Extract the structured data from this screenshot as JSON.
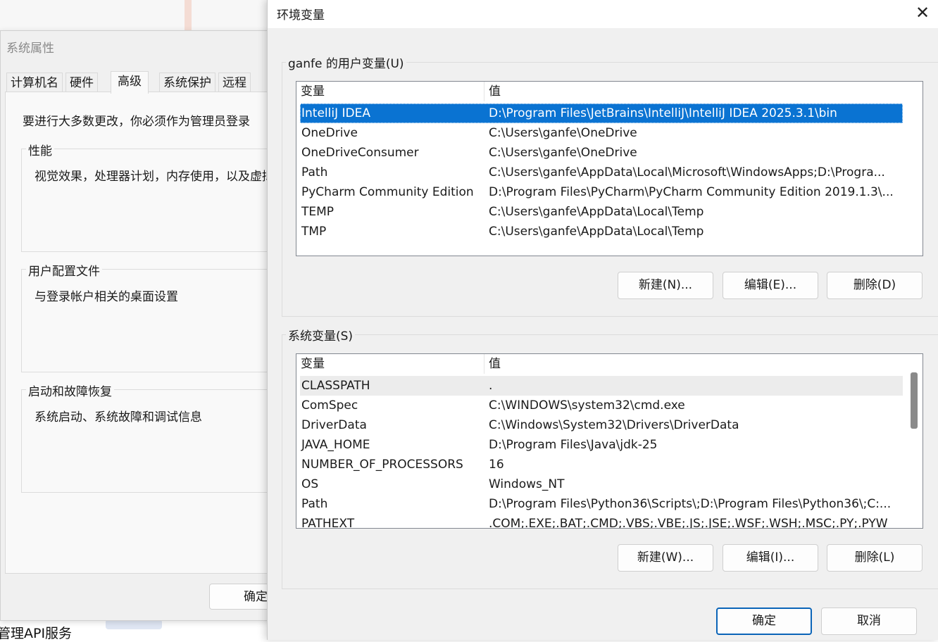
{
  "background": {
    "bottom_text": "管理API服务"
  },
  "system_properties": {
    "title": "系统属性",
    "tabs": [
      {
        "label": "计算机名"
      },
      {
        "label": "硬件"
      },
      {
        "label": "高级",
        "active": true
      },
      {
        "label": "系统保护"
      },
      {
        "label": "远程"
      }
    ],
    "admin_note": "要进行大多数更改，你必须作为管理员登录",
    "groups": [
      {
        "title": "性能",
        "desc": "视觉效果，处理器计划，内存使用，以及虚拟内存"
      },
      {
        "title": "用户配置文件",
        "desc": "与登录帐户相关的桌面设置"
      },
      {
        "title": "启动和故障恢复",
        "desc": "系统启动、系统故障和调试信息"
      }
    ],
    "ok_label": "确定"
  },
  "env_dialog": {
    "title": "环境变量",
    "close_glyph": "✕",
    "user_section": {
      "title": "ganfe 的用户变量(U)",
      "col_var": "变量",
      "col_val": "值",
      "rows": [
        {
          "var": "IntelliJ IDEA",
          "val": "D:\\Program Files\\JetBrains\\IntelliJ\\IntelliJ IDEA 2025.3.1\\bin",
          "selected": true
        },
        {
          "var": "OneDrive",
          "val": "C:\\Users\\ganfe\\OneDrive"
        },
        {
          "var": "OneDriveConsumer",
          "val": "C:\\Users\\ganfe\\OneDrive"
        },
        {
          "var": "Path",
          "val": "C:\\Users\\ganfe\\AppData\\Local\\Microsoft\\WindowsApps;D:\\Progra..."
        },
        {
          "var": "PyCharm Community Edition",
          "val": "D:\\Program Files\\PyCharm\\PyCharm Community Edition 2019.1.3\\..."
        },
        {
          "var": "TEMP",
          "val": "C:\\Users\\ganfe\\AppData\\Local\\Temp"
        },
        {
          "var": "TMP",
          "val": "C:\\Users\\ganfe\\AppData\\Local\\Temp"
        }
      ],
      "new_label": "新建(N)...",
      "edit_label": "编辑(E)...",
      "delete_label": "删除(D)"
    },
    "system_section": {
      "title": "系统变量(S)",
      "col_var": "变量",
      "col_val": "值",
      "rows": [
        {
          "var": "CLASSPATH",
          "val": "."
        },
        {
          "var": "ComSpec",
          "val": "C:\\WINDOWS\\system32\\cmd.exe"
        },
        {
          "var": "DriverData",
          "val": "C:\\Windows\\System32\\Drivers\\DriverData"
        },
        {
          "var": "JAVA_HOME",
          "val": "D:\\Program Files\\Java\\jdk-25"
        },
        {
          "var": "NUMBER_OF_PROCESSORS",
          "val": "16"
        },
        {
          "var": "OS",
          "val": "Windows_NT"
        },
        {
          "var": "Path",
          "val": "D:\\Program Files\\Python36\\Scripts\\;D:\\Program Files\\Python36\\;C:..."
        },
        {
          "var": "PATHEXT",
          "val": ".COM;.EXE;.BAT;.CMD;.VBS;.VBE;.JS;.JSE;.WSF;.WSH;.MSC;.PY;.PYW"
        }
      ],
      "new_label": "新建(W)...",
      "edit_label": "编辑(I)...",
      "delete_label": "删除(L)"
    },
    "ok_label": "确定",
    "cancel_label": "取消"
  }
}
